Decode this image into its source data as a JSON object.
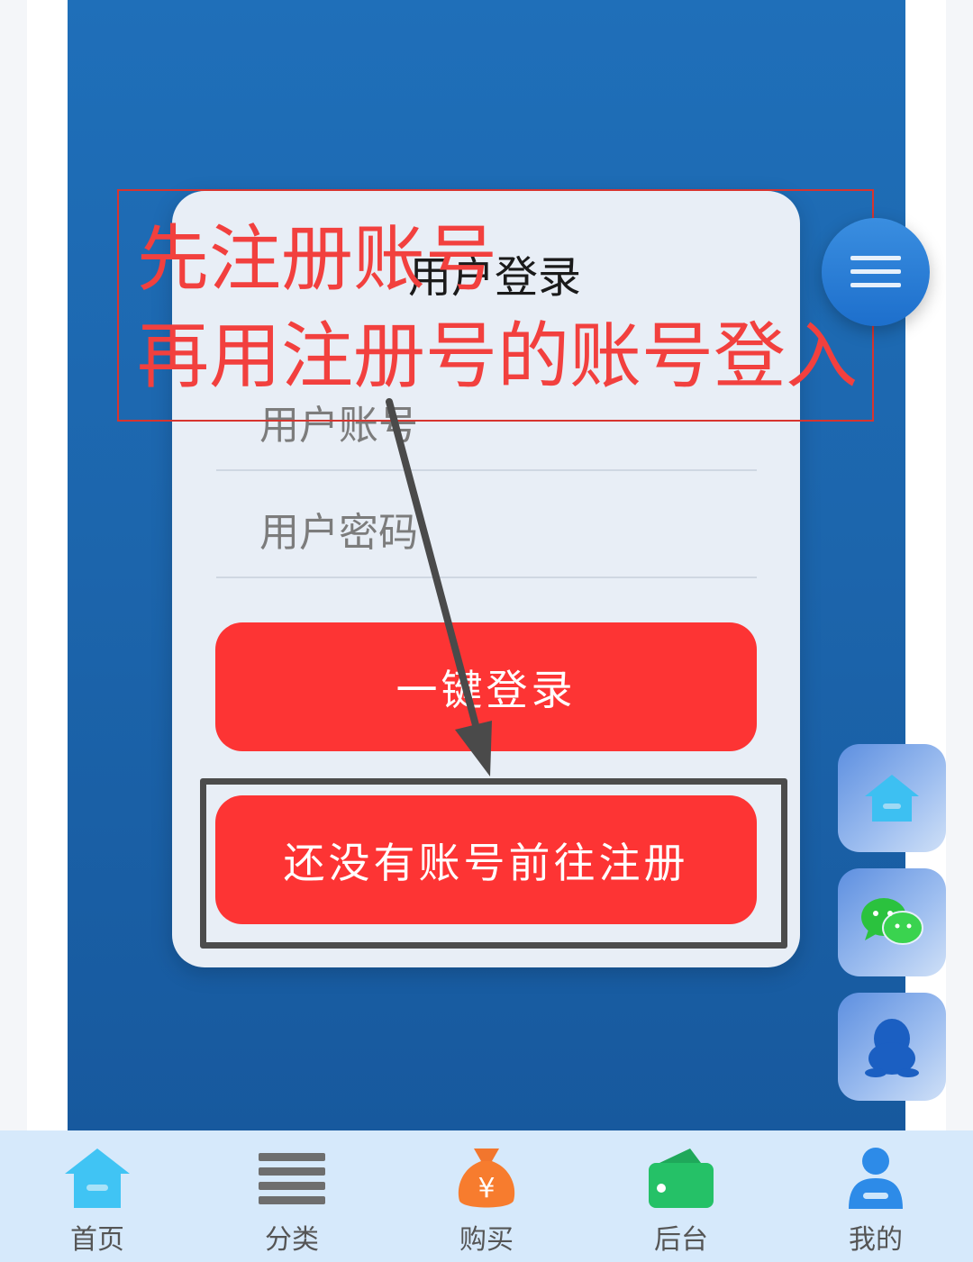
{
  "login": {
    "title": "用户登录",
    "username_placeholder": "用户账号",
    "password_placeholder": "用户密码",
    "login_button": "一键登录",
    "register_button": "还没有账号前往注册"
  },
  "annotation": {
    "line1": "先注册账号",
    "line2": "再用注册号的账号登入"
  },
  "side_buttons": [
    "home-icon",
    "wechat-icon",
    "qq-icon"
  ],
  "tabbar": {
    "items": [
      {
        "label": "首页",
        "icon": "home-icon"
      },
      {
        "label": "分类",
        "icon": "list-icon"
      },
      {
        "label": "购买",
        "icon": "money-bag-icon"
      },
      {
        "label": "后台",
        "icon": "wallet-icon"
      },
      {
        "label": "我的",
        "icon": "user-icon"
      }
    ]
  },
  "colors": {
    "primary_blue": "#1f6fb9",
    "button_red": "#fd3434",
    "annotation_red": "#f2403e",
    "tabbar_bg": "#d6e9fb"
  }
}
